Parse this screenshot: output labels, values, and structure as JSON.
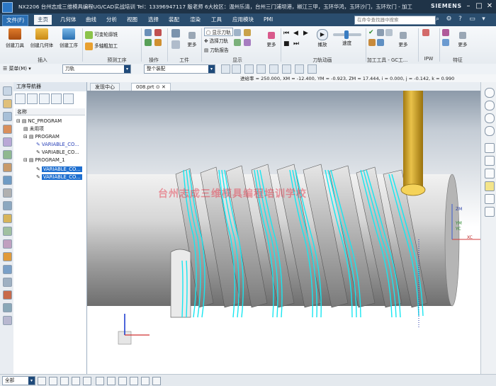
{
  "title_bar": {
    "title": "NX2206 台州志成三维模具编程UG/CAD实战培训 Tel：13396947117 殷老师 6大校区：温州乐清，台州三门浦坝港，椒江三甲，玉环华鸿，玉环沙门，玉环坎门 - 加工",
    "brand": "SIEMENS",
    "minimize": "–",
    "maximize": "□",
    "close": "✕"
  },
  "menu": {
    "file": "文件(F)",
    "items": [
      "主页",
      "几何体",
      "曲线",
      "分析",
      "视图",
      "选择",
      "装配",
      "渲染",
      "工具",
      "应用模块",
      "PMI"
    ],
    "active_index": 0,
    "search_placeholder": "在命令查找器中搜索"
  },
  "ribbon": {
    "insert_group": {
      "label": "插入",
      "buttons": [
        "创建刀具",
        "创建几何体",
        "创建工序"
      ]
    },
    "preset_group": {
      "label": "预测工序",
      "buttons": [
        "可变轮廓铣",
        "多轴粗加工"
      ]
    },
    "operation_group": {
      "label": "操作",
      "more": "更多"
    },
    "workpiece_group": {
      "label": "工件",
      "more": "更多"
    },
    "display_group": {
      "label": "显示",
      "buttons": [
        "显示刀轨",
        "选择刀轨",
        "刀轨报告"
      ],
      "more": "更多"
    },
    "toolpath_anim_group": {
      "label": "刀轨动画",
      "buttons": [
        "播放",
        "速度"
      ]
    },
    "machine_tool_group": {
      "label": "加工工具 - GC工...",
      "more": "更多"
    },
    "ipw_group": {
      "label": "IPW",
      "more": "更多"
    },
    "feature_group": {
      "label": "特征",
      "more": "更多"
    }
  },
  "toolbar": {
    "menu_button": "菜单(M)",
    "filter_value": "刀轨",
    "assembly_value": "整个装配",
    "readout": "进给率 = 250.000, XM = -12.400, YM = -0.923, ZM = 17.444, i = 0.000, j = -0.142, k = 0.990"
  },
  "navigator": {
    "title": "工序导航器",
    "column_header": "名称",
    "nodes": [
      {
        "label": "NC_PROGRAM",
        "level": 0,
        "selected": false,
        "style": "normal"
      },
      {
        "label": "未用项",
        "level": 1,
        "selected": false,
        "style": "normal"
      },
      {
        "label": "PROGRAM",
        "level": 1,
        "selected": false,
        "style": "normal"
      },
      {
        "label": "VARIABLE_CO...",
        "level": 2,
        "selected": false,
        "style": "blue"
      },
      {
        "label": "VARIABLE_CO...",
        "level": 2,
        "selected": false,
        "style": "normal"
      },
      {
        "label": "PROGRAM_1",
        "level": 1,
        "selected": false,
        "style": "normal"
      },
      {
        "label": "VARIABLE_CO...",
        "level": 2,
        "selected": true,
        "style": "normal"
      },
      {
        "label": "VARIABLE_CO...",
        "level": 2,
        "selected": true,
        "style": "normal"
      }
    ]
  },
  "tabs": [
    {
      "label": "发现中心",
      "active": false
    },
    {
      "label": "008.prt ⊙ ✕",
      "active": true
    }
  ],
  "viewport": {
    "watermark": "台州志成三维模具编程培训学校",
    "axis_labels": {
      "zm": "ZM",
      "ym": "YM",
      "xc": "XC",
      "yc": "YC"
    }
  },
  "statusbar": {
    "filter_value": "全部"
  },
  "colors": {
    "title_bg": "#1f3347",
    "menu_bg": "#2a4d6e",
    "toolpath": "#18e6f0",
    "tool": "#d8a81c",
    "selection": "#1e6fd0"
  }
}
